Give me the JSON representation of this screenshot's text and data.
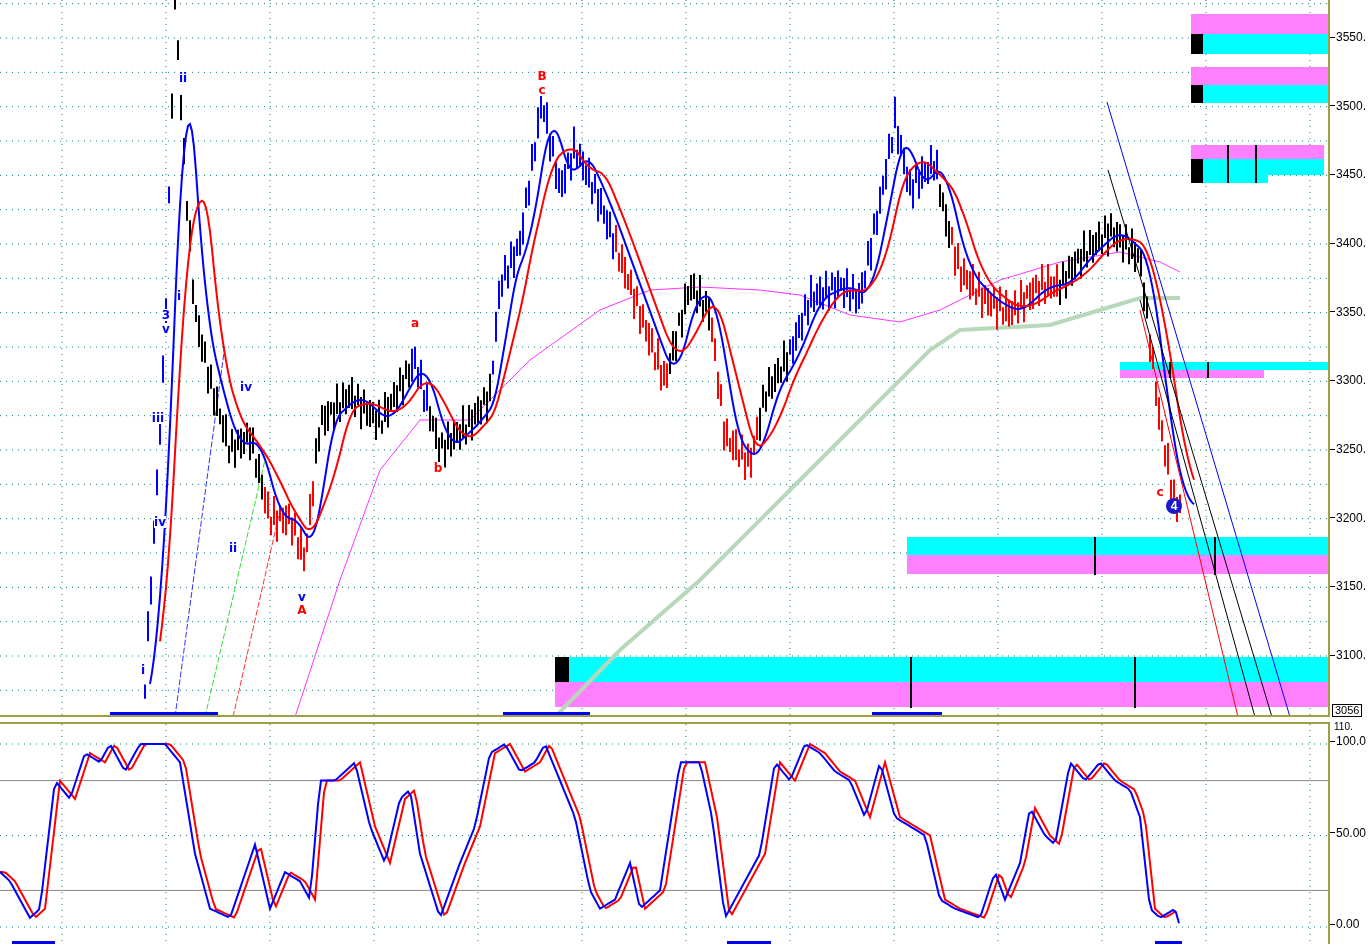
{
  "price_panel": {
    "axis_labels": [
      "3550.",
      "3500.",
      "3450.",
      "3400.",
      "3350.",
      "3300.",
      "3250.",
      "3200.",
      "3150.",
      "3100."
    ],
    "last_value": "3056",
    "wave_labels": [
      {
        "text": "ii",
        "color": "#0000ff"
      },
      {
        "text": "i",
        "color": "#0000ff"
      },
      {
        "text": "3",
        "color": "#0000ff"
      },
      {
        "text": "v",
        "color": "#0000ff"
      },
      {
        "text": "iii",
        "color": "#0000ff"
      },
      {
        "text": "iv",
        "color": "#0000ff"
      },
      {
        "text": "i",
        "color": "#0000ff"
      },
      {
        "text": "iv",
        "color": "#0000ff"
      },
      {
        "text": "ii",
        "color": "#0000ff"
      },
      {
        "text": "v",
        "color": "#0000ff"
      },
      {
        "text": "A",
        "color": "#ff0000"
      },
      {
        "text": "a",
        "color": "#ff0000"
      },
      {
        "text": "b",
        "color": "#ff0000"
      },
      {
        "text": "B",
        "color": "#ff0000"
      },
      {
        "text": "c",
        "color": "#ff0000"
      },
      {
        "text": "c",
        "color": "#ff0000"
      }
    ],
    "wave_marker": "4"
  },
  "oscillator_panel": {
    "top_label": "110.",
    "axis_labels": [
      "100.0",
      "50.00",
      "0.00"
    ]
  }
}
